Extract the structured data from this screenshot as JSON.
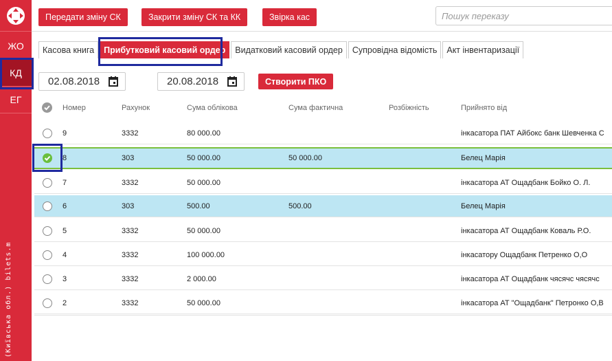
{
  "sidebar": {
    "logo": "arrows-cross-logo",
    "items": [
      {
        "label": "ЖО"
      },
      {
        "label": "КД",
        "active": true
      },
      {
        "label": "ЕГ"
      }
    ],
    "footer_text": "(Київська обл.) bilets.m"
  },
  "toolbar": {
    "transfer_shift": "Передати зміну СК",
    "close_shift": "Закрити зміну СК та КК",
    "reconcile": "Звірка кас"
  },
  "search": {
    "placeholder": "Пошук переказу"
  },
  "tabs": [
    {
      "label": "Касова книга"
    },
    {
      "label": "Прибутковий касовий ордер",
      "active": true
    },
    {
      "label": "Видатковий касовий ордер"
    },
    {
      "label": "Супровідна відомість"
    },
    {
      "label": "Акт інвентаризації"
    }
  ],
  "filters": {
    "date_from": "02.08.2018",
    "date_to": "20.08.2018",
    "create_label": "Створити ПКО"
  },
  "table": {
    "columns": [
      "Номер",
      "Рахунок",
      "Сума облікова",
      "Сума фактична",
      "Розбіжність",
      "Прийнято від"
    ],
    "rows": [
      {
        "num": "9",
        "account": "3332",
        "sum_book": "80 000.00",
        "sum_actual": "",
        "diff": "",
        "from": "інкасатора ПАТ Айбокс банк Шевченка С"
      },
      {
        "num": "8",
        "account": "303",
        "sum_book": "50 000.00",
        "sum_actual": "50 000.00",
        "diff": "",
        "from": "Белец Марія"
      },
      {
        "num": "7",
        "account": "3332",
        "sum_book": "50 000.00",
        "sum_actual": "",
        "diff": "",
        "from": "інкасатора АТ Ощадбанк Бойко О. Л."
      },
      {
        "num": "6",
        "account": "303",
        "sum_book": "500.00",
        "sum_actual": "500.00",
        "diff": "",
        "from": "Белец Марія"
      },
      {
        "num": "5",
        "account": "3332",
        "sum_book": "50 000.00",
        "sum_actual": "",
        "diff": "",
        "from": "інкасатора АТ Ощадбанк Коваль Р.О."
      },
      {
        "num": "4",
        "account": "3332",
        "sum_book": "100 000.00",
        "sum_actual": "",
        "diff": "",
        "from": "інкасатору Ощадбанк Петренко О,О"
      },
      {
        "num": "3",
        "account": "3332",
        "sum_book": "2 000.00",
        "sum_actual": "",
        "diff": "",
        "from": "інкасатора АТ Ощадбанк чясячс чясячс"
      },
      {
        "num": "2",
        "account": "3332",
        "sum_book": "50 000.00",
        "sum_actual": "",
        "diff": "",
        "from": "інкасатора АТ \"Ощадбанк\" Петронко О,В"
      }
    ]
  },
  "colors": {
    "accent": "#d92a3a",
    "active_side": "#a31424",
    "row_highlight": "#bde6f3",
    "check": "#6abf3d",
    "annotation": "#1f2a9e"
  }
}
